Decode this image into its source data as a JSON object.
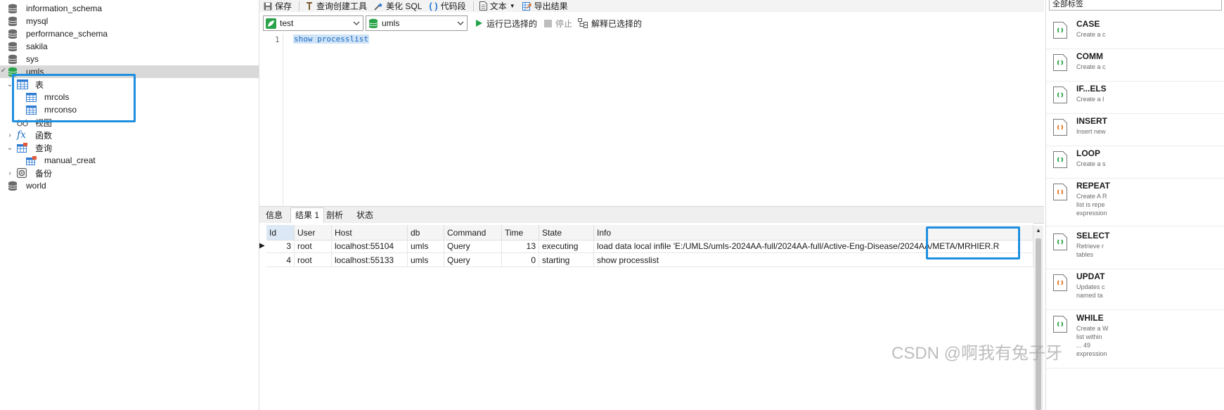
{
  "tree": {
    "databases_top": [
      "information_schema",
      "mysql",
      "performance_schema",
      "sakila",
      "sys"
    ],
    "selected_db": "umls",
    "children": {
      "tables": {
        "label": "表",
        "items": [
          "mrcols",
          "mrconso"
        ]
      },
      "views": {
        "label": "视图"
      },
      "functions": {
        "label": "函数"
      },
      "queries": {
        "label": "查询",
        "items": [
          "manual_creat"
        ]
      },
      "backups": {
        "label": "备份"
      }
    },
    "databases_bottom": [
      "world"
    ]
  },
  "toolbar": {
    "save": "保存",
    "query_builder": "查询创建工具",
    "beautify": "美化 SQL",
    "snippet": "代码段",
    "text": "文本",
    "export": "导出结果"
  },
  "selectors": {
    "connection": "test",
    "database": "umls",
    "run_selected": "运行已选择的",
    "stop": "停止",
    "explain": "解释已选择的"
  },
  "editor": {
    "line_number": "1",
    "code": "show processlist"
  },
  "results": {
    "tabs": [
      "信息",
      "结果 1",
      "剖析",
      "状态"
    ],
    "active_tab_index": 1,
    "columns": [
      "Id",
      "User",
      "Host",
      "db",
      "Command",
      "Time",
      "State",
      "Info"
    ],
    "rows": [
      [
        "3",
        "root",
        "localhost:55104",
        "umls",
        "Query",
        "13",
        "executing",
        "load data local infile 'E:/UMLS/umls-2024AA-full/2024AA-full/Active-Eng-Disease/2024AA/META/MRHIER.R"
      ],
      [
        "4",
        "root",
        "localhost:55133",
        "umls",
        "Query",
        "0",
        "starting",
        "show processlist"
      ]
    ]
  },
  "snippets": {
    "filter": "全部标签",
    "items": [
      {
        "title": "CASE",
        "desc": "Create a c"
      },
      {
        "title": "COMM",
        "desc": "Create a c"
      },
      {
        "title": "IF...ELS",
        "desc": "Create a I"
      },
      {
        "title": "INSERT",
        "desc": "Insert new"
      },
      {
        "title": "LOOP",
        "desc": "Create a s"
      },
      {
        "title": "REPEAT",
        "desc": "Create A R\nlist is repe\nexpression"
      },
      {
        "title": "SELECT",
        "desc": "Retrieve r\ntables"
      },
      {
        "title": "UPDAT",
        "desc": "Updates c\nnamed ta"
      },
      {
        "title": "WHILE",
        "desc": "Create a W\nlist within\n... 49\nexpression"
      }
    ]
  },
  "watermark": "CSDN @啊我有兔子牙",
  "colors": {
    "highlight": "#1e8fe0",
    "db_icon": "#666666",
    "selected_db_icon": "#2aa34a"
  }
}
